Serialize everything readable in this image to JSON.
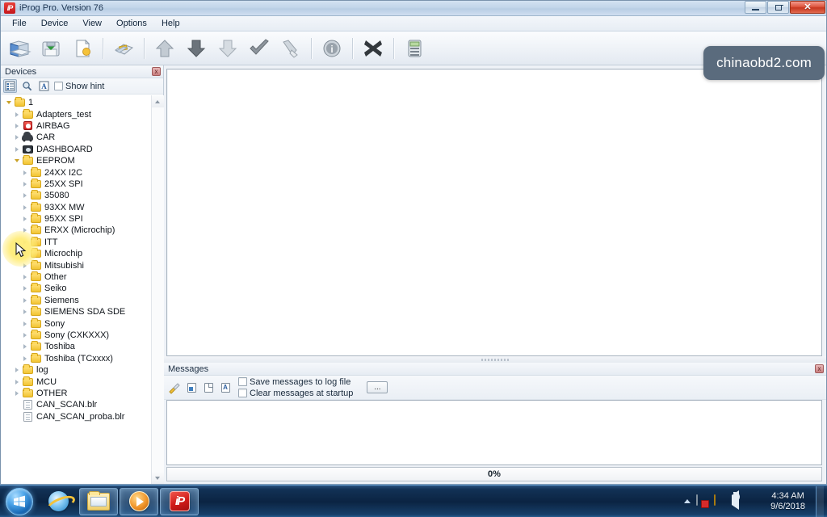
{
  "window": {
    "title": "iProg Pro. Version 76",
    "app_icon": "iprog-app-icon",
    "minimize_label": "Minimize",
    "restore_label": "Restore",
    "close_label": "Close"
  },
  "menu": {
    "items": [
      {
        "label": "File"
      },
      {
        "label": "Device"
      },
      {
        "label": "View"
      },
      {
        "label": "Options"
      },
      {
        "label": "Help"
      }
    ]
  },
  "toolbar": {
    "buttons": [
      {
        "name": "open-file-button",
        "icon": "open-folder-blue-icon",
        "title": "Open"
      },
      {
        "name": "save-file-button",
        "icon": "save-disk-green-icon",
        "title": "Save"
      },
      {
        "name": "new-file-button",
        "icon": "new-document-icon",
        "title": "New"
      },
      {
        "name": "device-select-button",
        "icon": "chip-icon",
        "title": "Select device"
      },
      {
        "name": "read-button",
        "icon": "arrow-up-icon",
        "title": "Read"
      },
      {
        "name": "write-button",
        "icon": "arrow-down-dark-icon",
        "title": "Write"
      },
      {
        "name": "verify-download-button",
        "icon": "arrow-down-light-icon",
        "title": "Download"
      },
      {
        "name": "verify-button",
        "icon": "check-mark-icon",
        "title": "Verify"
      },
      {
        "name": "erase-button",
        "icon": "erase-brush-icon",
        "title": "Erase"
      },
      {
        "name": "info-button",
        "icon": "info-circle-icon",
        "title": "Info"
      },
      {
        "name": "cancel-button",
        "icon": "cross-x-icon",
        "title": "Cancel"
      },
      {
        "name": "calculator-button",
        "icon": "calculator-icon",
        "title": "Calculator"
      }
    ]
  },
  "watermark": {
    "text": "chinaobd2.com"
  },
  "devices_panel": {
    "caption": "Devices",
    "close_label": "x",
    "toolbar": {
      "tree_view_button": "tree-view-icon",
      "search_button": "search-icon",
      "font_button": "font-A-icon",
      "show_hint_label": "Show hint",
      "show_hint_checked": false
    },
    "tree": [
      {
        "label": "1",
        "icon": "folder",
        "level": 0,
        "expander": "open"
      },
      {
        "label": "Adapters_test",
        "icon": "folder",
        "level": 1,
        "expander": "closed"
      },
      {
        "label": "AIRBAG",
        "icon": "airbag",
        "level": 1,
        "expander": "closed"
      },
      {
        "label": "CAR",
        "icon": "car",
        "level": 1,
        "expander": "closed"
      },
      {
        "label": "DASHBOARD",
        "icon": "dashboard",
        "level": 1,
        "expander": "closed"
      },
      {
        "label": "EEPROM",
        "icon": "folder",
        "level": 1,
        "expander": "open"
      },
      {
        "label": "24XX I2C",
        "icon": "folder",
        "level": 2,
        "expander": "closed"
      },
      {
        "label": "25XX SPI",
        "icon": "folder",
        "level": 2,
        "expander": "closed"
      },
      {
        "label": "35080",
        "icon": "folder",
        "level": 2,
        "expander": "closed"
      },
      {
        "label": "93XX MW",
        "icon": "folder",
        "level": 2,
        "expander": "closed"
      },
      {
        "label": "95XX SPI",
        "icon": "folder",
        "level": 2,
        "expander": "closed"
      },
      {
        "label": "ERXX (Microchip)",
        "icon": "folder",
        "level": 2,
        "expander": "closed"
      },
      {
        "label": "ITT",
        "icon": "folder",
        "level": 2,
        "expander": "closed"
      },
      {
        "label": "Microchip",
        "icon": "folder",
        "level": 2,
        "expander": "closed"
      },
      {
        "label": "Mitsubishi",
        "icon": "folder",
        "level": 2,
        "expander": "closed"
      },
      {
        "label": "Other",
        "icon": "folder",
        "level": 2,
        "expander": "closed"
      },
      {
        "label": "Seiko",
        "icon": "folder",
        "level": 2,
        "expander": "closed"
      },
      {
        "label": "Siemens",
        "icon": "folder",
        "level": 2,
        "expander": "closed"
      },
      {
        "label": "SIEMENS SDA SDE",
        "icon": "folder",
        "level": 2,
        "expander": "closed"
      },
      {
        "label": "Sony",
        "icon": "folder",
        "level": 2,
        "expander": "closed"
      },
      {
        "label": "Sony (CXKXXX)",
        "icon": "folder",
        "level": 2,
        "expander": "closed"
      },
      {
        "label": "Toshiba",
        "icon": "folder",
        "level": 2,
        "expander": "closed"
      },
      {
        "label": "Toshiba (TCxxxx)",
        "icon": "folder",
        "level": 2,
        "expander": "closed"
      },
      {
        "label": "log",
        "icon": "folder",
        "level": 1,
        "expander": "closed"
      },
      {
        "label": "MCU",
        "icon": "folder",
        "level": 1,
        "expander": "closed"
      },
      {
        "label": "OTHER",
        "icon": "folder",
        "level": 1,
        "expander": "closed"
      },
      {
        "label": "CAN_SCAN.blr",
        "icon": "file",
        "level": 1,
        "expander": "none"
      },
      {
        "label": "CAN_SCAN_proba.blr",
        "icon": "file",
        "level": 1,
        "expander": "none"
      }
    ]
  },
  "messages_panel": {
    "caption": "Messages",
    "close_label": "x",
    "buttons": [
      {
        "name": "clear-messages-button",
        "icon": "broom-icon"
      },
      {
        "name": "save-messages-button",
        "icon": "save-doc-icon"
      },
      {
        "name": "copy-messages-button",
        "icon": "copy-doc-icon"
      },
      {
        "name": "message-font-button",
        "icon": "font-A-icon"
      }
    ],
    "save_to_log_label": "Save messages to log file",
    "save_to_log_checked": false,
    "clear_at_startup_label": "Clear messages at startup",
    "clear_at_startup_checked": false,
    "browse_button_label": "...",
    "log_text": ""
  },
  "progress": {
    "value_label": "0%",
    "percent": 0
  },
  "taskbar": {
    "start_label": "Start",
    "items": [
      {
        "name": "taskbar-internet-explorer",
        "icon": "internet-explorer-icon",
        "active": false
      },
      {
        "name": "taskbar-windows-explorer",
        "icon": "windows-explorer-icon",
        "active": true
      },
      {
        "name": "taskbar-media-player",
        "icon": "media-player-icon",
        "active": true
      },
      {
        "name": "taskbar-iprog",
        "icon": "iprog-icon",
        "active": true,
        "label": "iP"
      }
    ],
    "tray": [
      {
        "name": "tray-network-icon",
        "icon": "network-error-icon"
      },
      {
        "name": "tray-action-center-icon",
        "icon": "flag-icon"
      },
      {
        "name": "tray-volume-icon",
        "icon": "speaker-icon"
      },
      {
        "name": "tray-security-icon",
        "icon": "shield-icon"
      }
    ],
    "clock": {
      "time": "4:34 AM",
      "date": "9/6/2018"
    }
  },
  "colors": {
    "accent": "#1667b4",
    "folder": "#f2c431",
    "alert_red": "#c4161c",
    "watermark_bg": "#5a6b7d"
  }
}
